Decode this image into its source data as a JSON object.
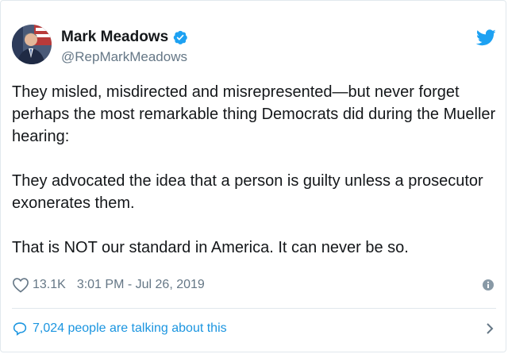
{
  "author": {
    "display_name": "Mark Meadows",
    "handle": "@RepMarkMeadows",
    "verified": true
  },
  "tweet": {
    "text": "They misled, misdirected and misrepresented—but never forget perhaps the most remarkable thing Democrats did during the Mueller hearing:\n\nThey advocated the idea that a person is guilty unless a prosecutor exonerates them.\n\nThat is NOT our standard in America. It can never be so."
  },
  "meta": {
    "likes": "13.1K",
    "timestamp": "3:01 PM - Jul 26, 2019"
  },
  "footer": {
    "talking_text": "7,024 people are talking about this"
  },
  "colors": {
    "twitter_blue": "#1da1f2",
    "link_blue": "#1b95e0",
    "secondary_text": "#657786",
    "divider": "#e1e8ed"
  },
  "icons": [
    "avatar",
    "verified-badge-icon",
    "twitter-bird-icon",
    "heart-icon",
    "info-icon",
    "comment-icon",
    "chevron-right-icon"
  ]
}
